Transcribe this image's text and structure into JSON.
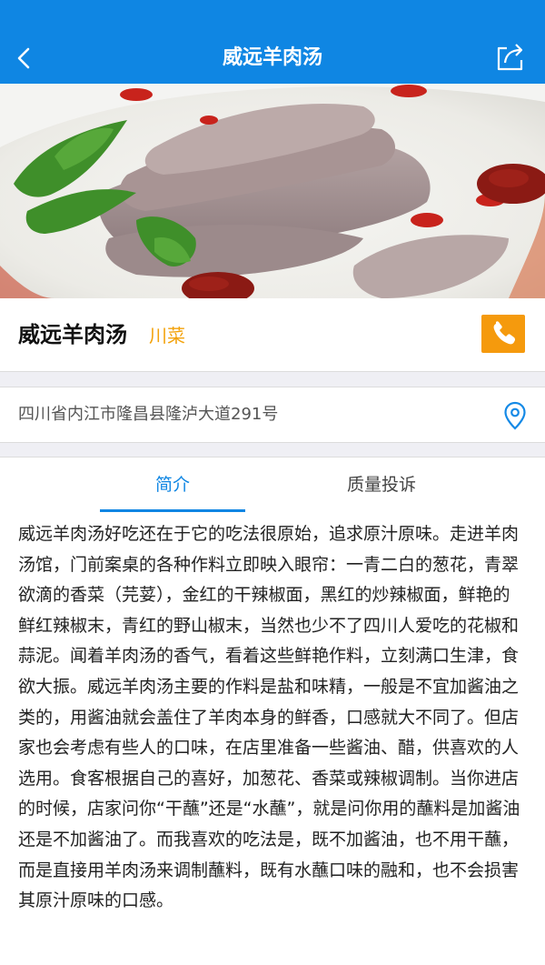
{
  "header": {
    "title": "威远羊肉汤",
    "back_icon": "chevron-left-icon",
    "share_icon": "share-icon",
    "bg_color": "#0f86e3"
  },
  "restaurant": {
    "name": "威远羊肉汤",
    "category": "川菜",
    "category_color": "#f3a20b",
    "call_icon": "phone-icon",
    "call_color": "#f59a0d"
  },
  "address": {
    "text": "四川省内江市隆昌县隆泸大道291号",
    "icon": "location-pin-icon"
  },
  "tabs": [
    {
      "label": "简介",
      "active": true
    },
    {
      "label": "质量投诉",
      "active": false
    }
  ],
  "description": "威远羊肉汤好吃还在于它的吃法很原始，追求原汁原味。走进羊肉汤馆，门前案桌的各种作料立即映入眼帘：一青二白的葱花，青翠欲滴的香菜（芫荽），金红的干辣椒面，黑红的炒辣椒面，鲜艳的鲜红辣椒末，青红的野山椒末，当然也少不了四川人爱吃的花椒和蒜泥。闻着羊肉汤的香气，看着这些鲜艳作料，立刻满口生津，食欲大振。威远羊肉汤主要的作料是盐和味精，一般是不宜加酱油之类的，用酱油就会盖住了羊肉本身的鲜香，口感就大不同了。但店家也会考虑有些人的口味，在店里准备一些酱油、醋，供喜欢的人选用。食客根据自己的喜好，加葱花、香菜或辣椒调制。当你进店的时候，店家问你“干蘸”还是“水蘸”，就是问你用的蘸料是加酱油还是不加酱油了。而我喜欢的吃法是，既不加酱油，也不用干蘸，而是直接用羊肉汤来调制蘸料，既有水蘸口味的融和，也不会损害其原汁原味的口感。"
}
